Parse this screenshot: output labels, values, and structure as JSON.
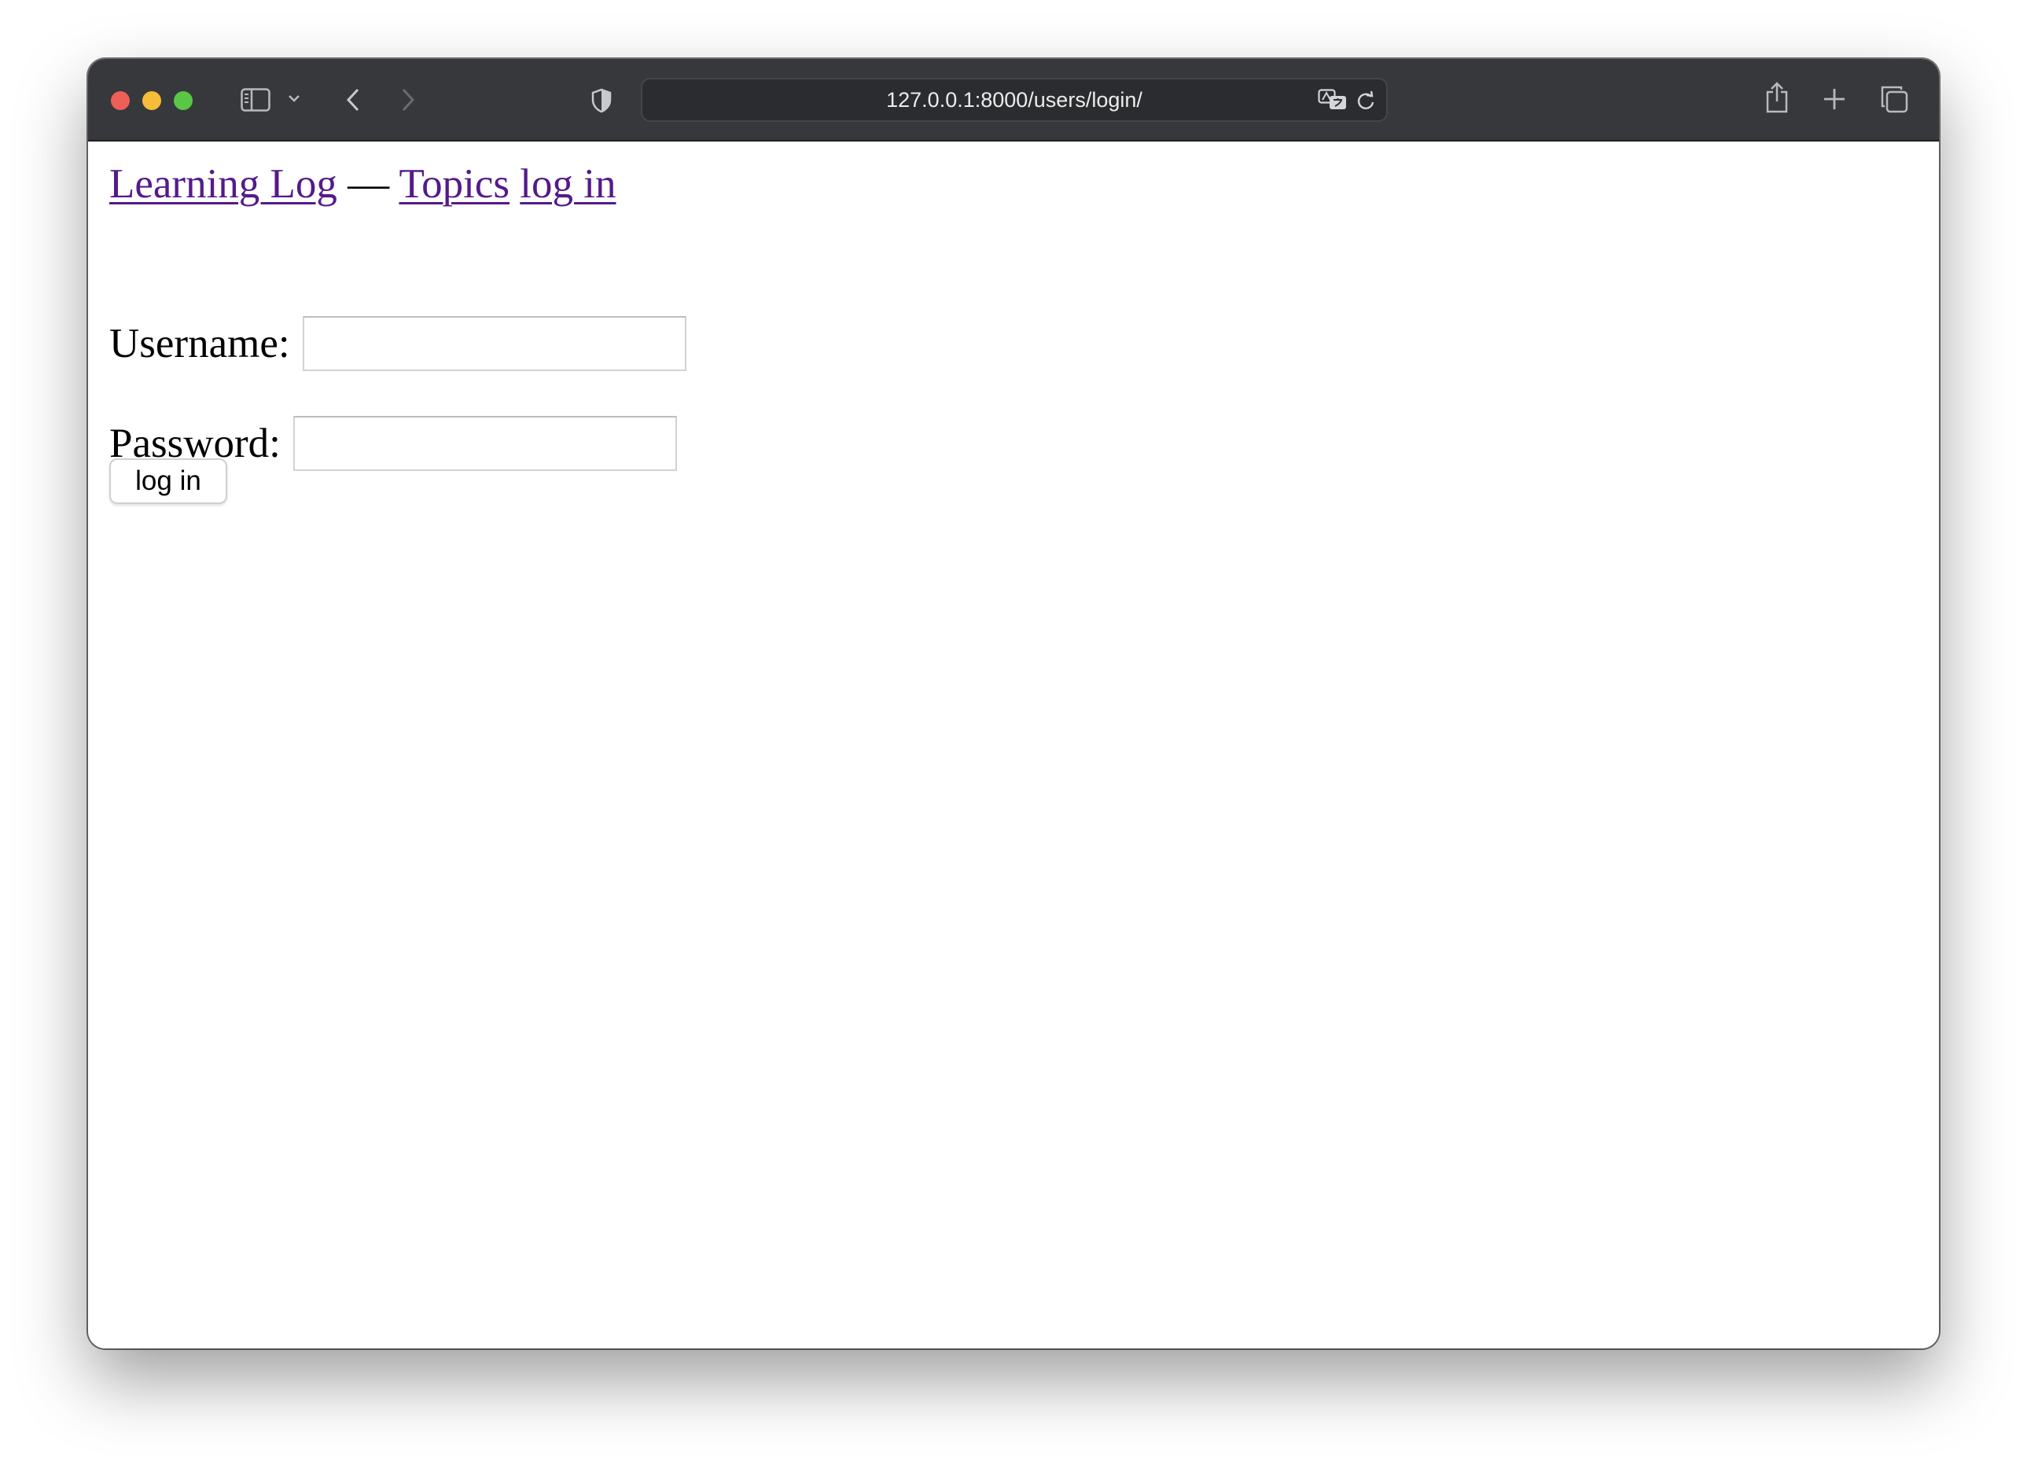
{
  "browser": {
    "url": "127.0.0.1:8000/users/login/",
    "colors": {
      "toolbar": "#37383b",
      "close": "#ee5f57",
      "minimize": "#f6bd3b",
      "zoom": "#5ac645"
    },
    "icons": [
      "sidebar-icon",
      "chevron-down-icon",
      "back-icon",
      "forward-icon",
      "shield-icon",
      "translate-icon",
      "reload-icon",
      "share-icon",
      "new-tab-icon",
      "tab-overview-icon"
    ]
  },
  "page": {
    "nav": {
      "home_link": "Learning Log",
      "separator": "—",
      "topics_link": "Topics",
      "login_link": "log in"
    },
    "form": {
      "username_label": "Username:",
      "password_label": "Password:",
      "username_value": "",
      "password_value": "",
      "submit_label": "log in"
    },
    "colors": {
      "visited_link": "#551a8b"
    }
  }
}
